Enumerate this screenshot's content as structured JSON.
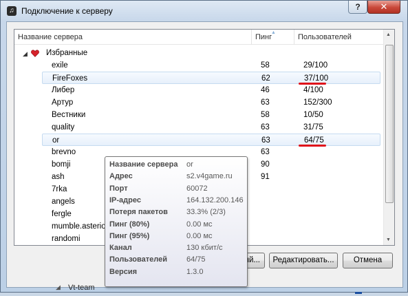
{
  "window": {
    "title": "Подключение к серверу",
    "help_label": "?",
    "close_label": "✕"
  },
  "list": {
    "columns": [
      "Название сервера",
      "Пинг",
      "Пользователей"
    ],
    "group": {
      "label": "Избранные"
    },
    "rows": [
      {
        "name": "exile",
        "ping": "58",
        "users": "29/100"
      },
      {
        "name": "FireFoxes",
        "ping": "62",
        "users": "37/100",
        "selected": true,
        "underlined": true
      },
      {
        "name": "Либер",
        "ping": "46",
        "users": "4/100"
      },
      {
        "name": "Артур",
        "ping": "63",
        "users": "152/300"
      },
      {
        "name": "Вестники",
        "ping": "58",
        "users": "10/50"
      },
      {
        "name": "quality",
        "ping": "63",
        "users": "31/75"
      },
      {
        "name": "or",
        "ping": "63",
        "users": "64/75",
        "selected": true,
        "underlined": true
      },
      {
        "name": "brevno",
        "ping": "63",
        "users": ""
      },
      {
        "name": "bomji",
        "ping": "90",
        "users": ""
      },
      {
        "name": "ash",
        "ping": "91",
        "users": ""
      },
      {
        "name": "7rka",
        "ping": "",
        "users": ""
      },
      {
        "name": "angels",
        "ping": "",
        "users": ""
      },
      {
        "name": "fergle",
        "ping": "",
        "users": ""
      },
      {
        "name": "mumble.asterios",
        "ping": "",
        "users": ""
      },
      {
        "name": "randomi",
        "ping": "",
        "users": ""
      }
    ]
  },
  "buttons": {
    "add": "ый...",
    "edit": "Редактировать...",
    "cancel": "Отмена"
  },
  "tooltip": {
    "rows": [
      {
        "k": "Название сервера",
        "v": "or"
      },
      {
        "k": "Адрес",
        "v": "s2.v4game.ru"
      },
      {
        "k": "Порт",
        "v": "60072"
      },
      {
        "k": "IP-адрес",
        "v": "164.132.200.146"
      },
      {
        "k": "Потеря пакетов",
        "v": "33.3% (2/3)"
      },
      {
        "k": "Пинг (80%)",
        "v": "0.00 мс"
      },
      {
        "k": "Пинг (95%)",
        "v": "0.00 мс"
      },
      {
        "k": "Канал",
        "v": "130 кбит/с"
      },
      {
        "k": "Пользователей",
        "v": "64/75"
      },
      {
        "k": "Версия",
        "v": "1.3.0"
      }
    ]
  },
  "background": {
    "text": "Vt-team"
  },
  "colors": {
    "accent_underline": "#e0101a",
    "selection": "#e7f0fb",
    "close": "#c9483a"
  },
  "icons": {
    "app": "mumble-icon",
    "group": "heart-icon"
  }
}
